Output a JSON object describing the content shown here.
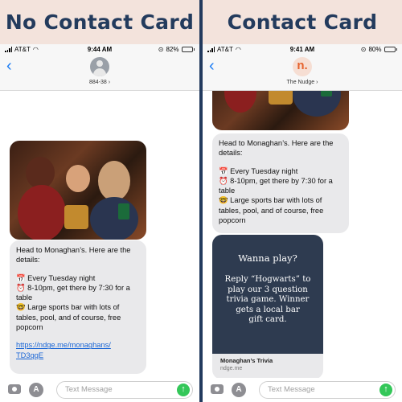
{
  "left": {
    "banner": "No Contact Card",
    "status": {
      "carrier": "AT&T",
      "time": "9:44 AM",
      "battery": "82%"
    },
    "contact_name": "884-38",
    "message": {
      "line1": "Head to Monaghan’s. Here are the",
      "line2": "details:",
      "item1": "📅 Every Tuesday night",
      "item2a": "⏰ 8-10pm, get there by 7:30 for a",
      "item2b": "table",
      "item3a": "🤓 Large sports bar with lots of",
      "item3b": "tables, pool, and of course, free",
      "item3c": "popcorn",
      "link1": "https://ndge.me/monaghans/",
      "link2": "TD3qqE"
    },
    "compose_placeholder": "Text Message"
  },
  "right": {
    "banner": "Contact Card",
    "status": {
      "carrier": "AT&T",
      "time": "9:41 AM",
      "battery": "80%"
    },
    "avatar_letter": "n.",
    "contact_name": "The Nudge",
    "message": {
      "line1": "Head to Monaghan’s. Here are the",
      "line2": "details:",
      "item1": "📅 Every Tuesday night",
      "item2a": "⏰ 8-10pm, get there by 7:30 for a",
      "item2b": "table",
      "item3a": "🤓 Large sports bar with lots of",
      "item3b": "tables, pool, and of course, free",
      "item3c": "popcorn"
    },
    "card": {
      "title": "Wanna play?",
      "body1": "Reply “Hogwarts” to",
      "body2": "play our 3 question",
      "body3": "trivia game. Winner",
      "body4": "gets a local bar",
      "body5": "gift card.",
      "caption": "Monaghan’s Trivia",
      "domain": "ndge.me"
    },
    "compose_placeholder": "Text Message"
  },
  "icons": {
    "back": "chevron-left-icon",
    "camera": "camera-icon",
    "apps": "app-store-icon",
    "send": "send-arrow-icon"
  },
  "colors": {
    "banner_bg": "#f3e3dc",
    "banner_text": "#233b5d",
    "divider": "#223a5e",
    "bubble_gray": "#e9e9eb",
    "ios_blue": "#1a7cf5",
    "send_green": "#34c759",
    "card_bg": "#2e3b50"
  }
}
